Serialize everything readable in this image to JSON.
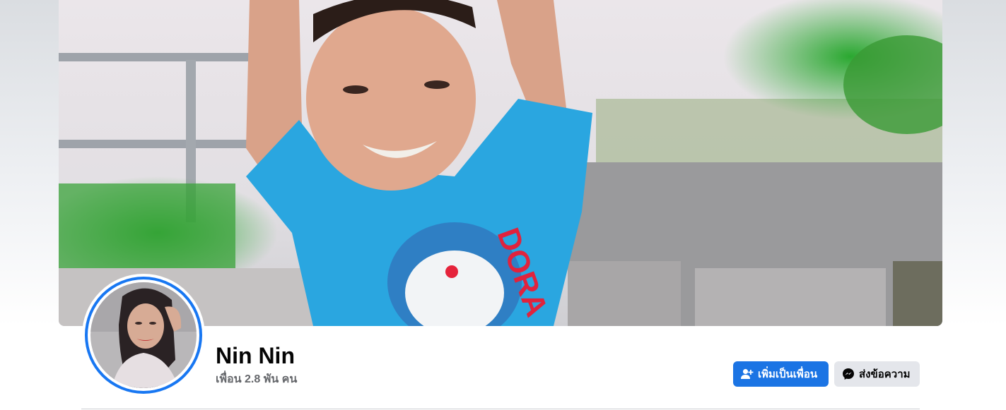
{
  "profile": {
    "name": "Nin Nin",
    "friends_count_text": "เพื่อน 2.8 พัน คน"
  },
  "actions": {
    "add_friend_label": "เพิ่มเป็นเพื่อน",
    "add_friend_icon": "add-friend-icon",
    "message_label": "ส่งข้อความ",
    "message_icon": "messenger-icon"
  },
  "colors": {
    "primary_button": "#1b74e4",
    "secondary_button": "#e4e6eb",
    "avatar_ring": "#1877f2",
    "name_text": "#050505",
    "secondary_text": "#65676b"
  }
}
